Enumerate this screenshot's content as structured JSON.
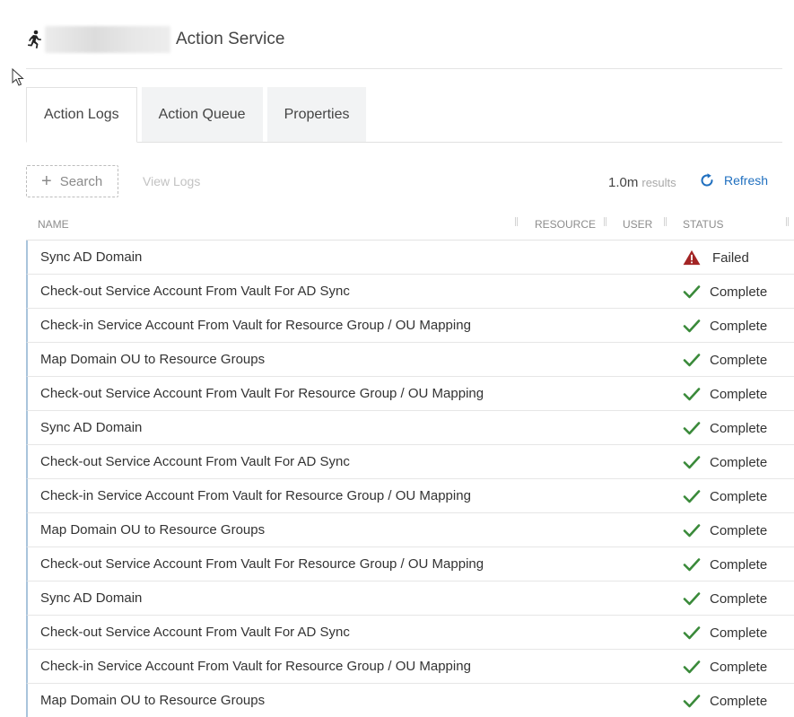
{
  "header": {
    "title": "Action Service",
    "icon": "runner-icon"
  },
  "tabs": [
    {
      "label": "Action Logs",
      "active": true
    },
    {
      "label": "Action Queue",
      "active": false
    },
    {
      "label": "Properties",
      "active": false
    }
  ],
  "toolbar": {
    "search_label": "Search",
    "view_logs_label": "View Logs",
    "results_count": "1.0m",
    "results_label": "results",
    "refresh_label": "Refresh"
  },
  "table": {
    "columns": [
      "NAME",
      "RESOURCE",
      "USER",
      "STATUS"
    ],
    "rows": [
      {
        "name": "Sync AD Domain",
        "status": "Failed"
      },
      {
        "name": "Check-out Service Account From Vault For AD Sync",
        "status": "Complete"
      },
      {
        "name": "Check-in Service Account From Vault for Resource Group / OU Mapping",
        "status": "Complete"
      },
      {
        "name": "Map Domain OU to Resource Groups",
        "status": "Complete"
      },
      {
        "name": "Check-out Service Account From Vault For Resource Group / OU Mapping",
        "status": "Complete"
      },
      {
        "name": "Sync AD Domain",
        "status": "Complete"
      },
      {
        "name": "Check-out Service Account From Vault For AD Sync",
        "status": "Complete"
      },
      {
        "name": "Check-in Service Account From Vault for Resource Group / OU Mapping",
        "status": "Complete"
      },
      {
        "name": "Map Domain OU to Resource Groups",
        "status": "Complete"
      },
      {
        "name": "Check-out Service Account From Vault For Resource Group / OU Mapping",
        "status": "Complete"
      },
      {
        "name": "Sync AD Domain",
        "status": "Complete"
      },
      {
        "name": "Check-out Service Account From Vault For AD Sync",
        "status": "Complete"
      },
      {
        "name": "Check-in Service Account From Vault for Resource Group / OU Mapping",
        "status": "Complete"
      },
      {
        "name": "Map Domain OU to Resource Groups",
        "status": "Complete"
      }
    ]
  },
  "colors": {
    "accent": "#1f6fbf",
    "complete": "#3a8a3a",
    "failed": "#a32525",
    "row_marker": "#a9c4dc"
  }
}
